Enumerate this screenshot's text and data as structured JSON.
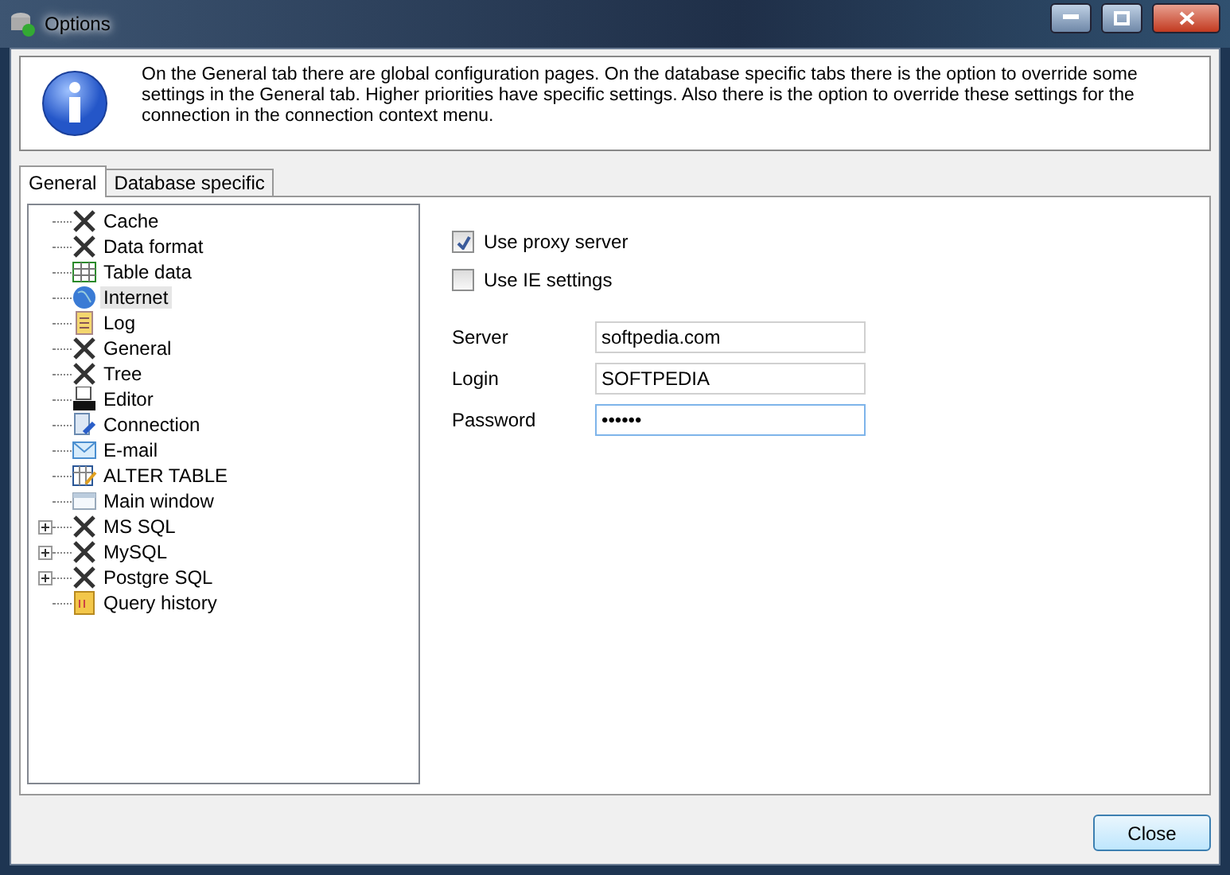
{
  "window": {
    "title": "Options",
    "controls": [
      {
        "kind": "minimize"
      },
      {
        "kind": "maximize"
      },
      {
        "kind": "close"
      }
    ]
  },
  "info": "On the General tab there are global configuration pages. On the database specific tabs there is the option to override some settings in the General tab. Higher priorities have specific settings. Also there is the option to override these settings for the connection in the connection context menu.",
  "tabs": [
    {
      "label": "General",
      "selected": true
    },
    {
      "label": "Database specific",
      "selected": false
    }
  ],
  "tree": [
    {
      "label": "Cache",
      "kind": "tools",
      "selected": false,
      "expandable": false
    },
    {
      "label": "Data format",
      "kind": "tools",
      "selected": false,
      "expandable": false
    },
    {
      "label": "Table data",
      "kind": "grid",
      "selected": false,
      "expandable": false
    },
    {
      "label": "Internet",
      "kind": "globe",
      "selected": true,
      "expandable": false
    },
    {
      "label": "Log",
      "kind": "notes",
      "selected": false,
      "expandable": false
    },
    {
      "label": "General",
      "kind": "tools",
      "selected": false,
      "expandable": false
    },
    {
      "label": "Tree",
      "kind": "tools",
      "selected": false,
      "expandable": false
    },
    {
      "label": "Editor",
      "kind": "sql",
      "selected": false,
      "expandable": false
    },
    {
      "label": "Connection",
      "kind": "plug",
      "selected": false,
      "expandable": false
    },
    {
      "label": "E-mail",
      "kind": "mail",
      "selected": false,
      "expandable": false
    },
    {
      "label": "ALTER TABLE",
      "kind": "editgrid",
      "selected": false,
      "expandable": false
    },
    {
      "label": "Main window",
      "kind": "window",
      "selected": false,
      "expandable": false
    },
    {
      "label": "MS SQL",
      "kind": "tools",
      "selected": false,
      "expandable": true
    },
    {
      "label": "MySQL",
      "kind": "tools",
      "selected": false,
      "expandable": true
    },
    {
      "label": "Postgre SQL",
      "kind": "tools",
      "selected": false,
      "expandable": true
    },
    {
      "label": "Query history",
      "kind": "history",
      "selected": false,
      "expandable": false
    }
  ],
  "checkboxes": [
    {
      "label": "Use proxy server",
      "checked": true
    },
    {
      "label": "Use IE settings",
      "checked": false
    }
  ],
  "fields": [
    {
      "label": "Server",
      "value": "softpedia.com",
      "focused": false
    },
    {
      "label": "Login",
      "value": "SOFTPEDIA",
      "focused": false
    },
    {
      "label": "Password",
      "value": "••••••",
      "focused": true
    }
  ],
  "buttons": [
    "Close"
  ]
}
